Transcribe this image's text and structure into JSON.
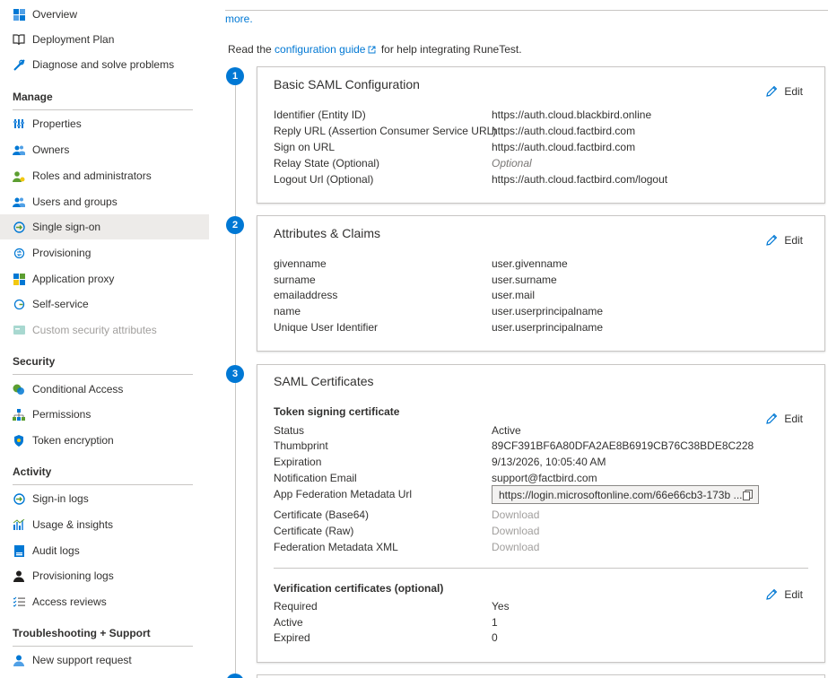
{
  "sidebar": {
    "top_items": [
      {
        "label": "Overview",
        "icon": "overview-grid-icon"
      },
      {
        "label": "Deployment Plan",
        "icon": "book-icon"
      },
      {
        "label": "Diagnose and solve problems",
        "icon": "wrench-icon"
      }
    ],
    "sections": {
      "manage": {
        "title": "Manage",
        "items": [
          {
            "label": "Properties",
            "icon": "properties-icon"
          },
          {
            "label": "Owners",
            "icon": "owners-icon"
          },
          {
            "label": "Roles and administrators",
            "icon": "roles-icon"
          },
          {
            "label": "Users and groups",
            "icon": "users-icon"
          },
          {
            "label": "Single sign-on",
            "icon": "sso-icon"
          },
          {
            "label": "Provisioning",
            "icon": "provisioning-icon"
          },
          {
            "label": "Application proxy",
            "icon": "app-proxy-icon"
          },
          {
            "label": "Self-service",
            "icon": "self-service-icon"
          },
          {
            "label": "Custom security attributes",
            "icon": "custom-attributes-icon"
          }
        ]
      },
      "security": {
        "title": "Security",
        "items": [
          {
            "label": "Conditional Access",
            "icon": "conditional-access-icon"
          },
          {
            "label": "Permissions",
            "icon": "permissions-icon"
          },
          {
            "label": "Token encryption",
            "icon": "shield-icon"
          }
        ]
      },
      "activity": {
        "title": "Activity",
        "items": [
          {
            "label": "Sign-in logs",
            "icon": "sign-in-logs-icon"
          },
          {
            "label": "Usage & insights",
            "icon": "usage-chart-icon"
          },
          {
            "label": "Audit logs",
            "icon": "audit-logs-icon"
          },
          {
            "label": "Provisioning logs",
            "icon": "provisioning-logs-icon"
          },
          {
            "label": "Access reviews",
            "icon": "access-reviews-icon"
          }
        ]
      },
      "troubleshooting": {
        "title": "Troubleshooting + Support",
        "items": [
          {
            "label": "New support request",
            "icon": "support-icon"
          }
        ]
      }
    }
  },
  "main": {
    "more_link": "more.",
    "guide": {
      "prefix": "Read the",
      "link": "configuration guide",
      "suffix": "for help integrating RuneTest."
    },
    "edit_label": "Edit",
    "steps": [
      "1",
      "2",
      "3"
    ],
    "basic_saml": {
      "title": "Basic SAML Configuration",
      "rows": [
        {
          "k": "Identifier (Entity ID)",
          "v": "https://auth.cloud.blackbird.online"
        },
        {
          "k": "Reply URL (Assertion Consumer Service URL)",
          "v": "https://auth.cloud.factbird.com"
        },
        {
          "k": "Sign on URL",
          "v": "https://auth.cloud.factbird.com"
        },
        {
          "k": "Relay State (Optional)",
          "v": "Optional"
        },
        {
          "k": "Logout Url (Optional)",
          "v": "https://auth.cloud.factbird.com/logout"
        }
      ]
    },
    "attributes": {
      "title": "Attributes & Claims",
      "rows": [
        {
          "k": "givenname",
          "v": "user.givenname"
        },
        {
          "k": "surname",
          "v": "user.surname"
        },
        {
          "k": "emailaddress",
          "v": "user.mail"
        },
        {
          "k": "name",
          "v": "user.userprincipalname"
        },
        {
          "k": "Unique User Identifier",
          "v": "user.userprincipalname"
        }
      ]
    },
    "certificates": {
      "title": "SAML Certificates",
      "token_heading": "Token signing certificate",
      "rows": [
        {
          "k": "Status",
          "v": "Active"
        },
        {
          "k": "Thumbprint",
          "v": "89CF391BF6A80DFA2AE8B6919CB76C38BDE8C228"
        },
        {
          "k": "Expiration",
          "v": "9/13/2026, 10:05:40 AM"
        },
        {
          "k": "Notification Email",
          "v": "support@factbird.com"
        },
        {
          "k": "App Federation Metadata Url",
          "v": "https://login.microsoftonline.com/66e66cb3-173b ..."
        },
        {
          "k": "Certificate (Base64)",
          "v": "Download"
        },
        {
          "k": "Certificate (Raw)",
          "v": "Download"
        },
        {
          "k": "Federation Metadata XML",
          "v": "Download"
        }
      ],
      "verification_heading": "Verification certificates (optional)",
      "verification_rows": [
        {
          "k": "Required",
          "v": "Yes"
        },
        {
          "k": "Active",
          "v": "1"
        },
        {
          "k": "Expired",
          "v": "0"
        }
      ]
    }
  },
  "colors": {
    "accent": "#0078d4",
    "selected_bg": "#edebe9",
    "border": "#c8c6c4"
  }
}
